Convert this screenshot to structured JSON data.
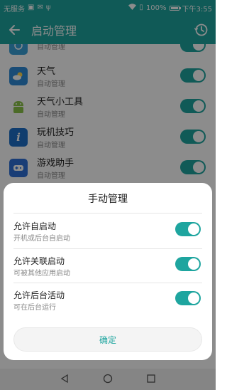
{
  "status_bar": {
    "carrier": "无服务",
    "battery": "100%",
    "time": "下午3:55"
  },
  "app_bar": {
    "title": "启动管理"
  },
  "apps": [
    {
      "name": "",
      "status": "自动管理",
      "icon": "partial-app-icon",
      "color": "#3aa0d8"
    },
    {
      "name": "天气",
      "status": "自动管理",
      "icon": "weather-icon",
      "color": "#2e8ad8"
    },
    {
      "name": "天气小工具",
      "status": "自动管理",
      "icon": "android-icon",
      "color": "#8bc34a"
    },
    {
      "name": "玩机技巧",
      "status": "自动管理",
      "icon": "info-icon",
      "color": "#1e6fc8"
    },
    {
      "name": "游戏助手",
      "status": "自动管理",
      "icon": "game-icon",
      "color": "#2f6fd8"
    }
  ],
  "dialog": {
    "title": "手动管理",
    "options": [
      {
        "label": "允许自启动",
        "sub": "开机或后台自启动",
        "enabled": true
      },
      {
        "label": "允许关联启动",
        "sub": "可被其他应用启动",
        "enabled": true
      },
      {
        "label": "允许后台活动",
        "sub": "可在后台运行",
        "enabled": true
      }
    ],
    "confirm_label": "确定"
  },
  "colors": {
    "accent": "#1ea59f"
  }
}
